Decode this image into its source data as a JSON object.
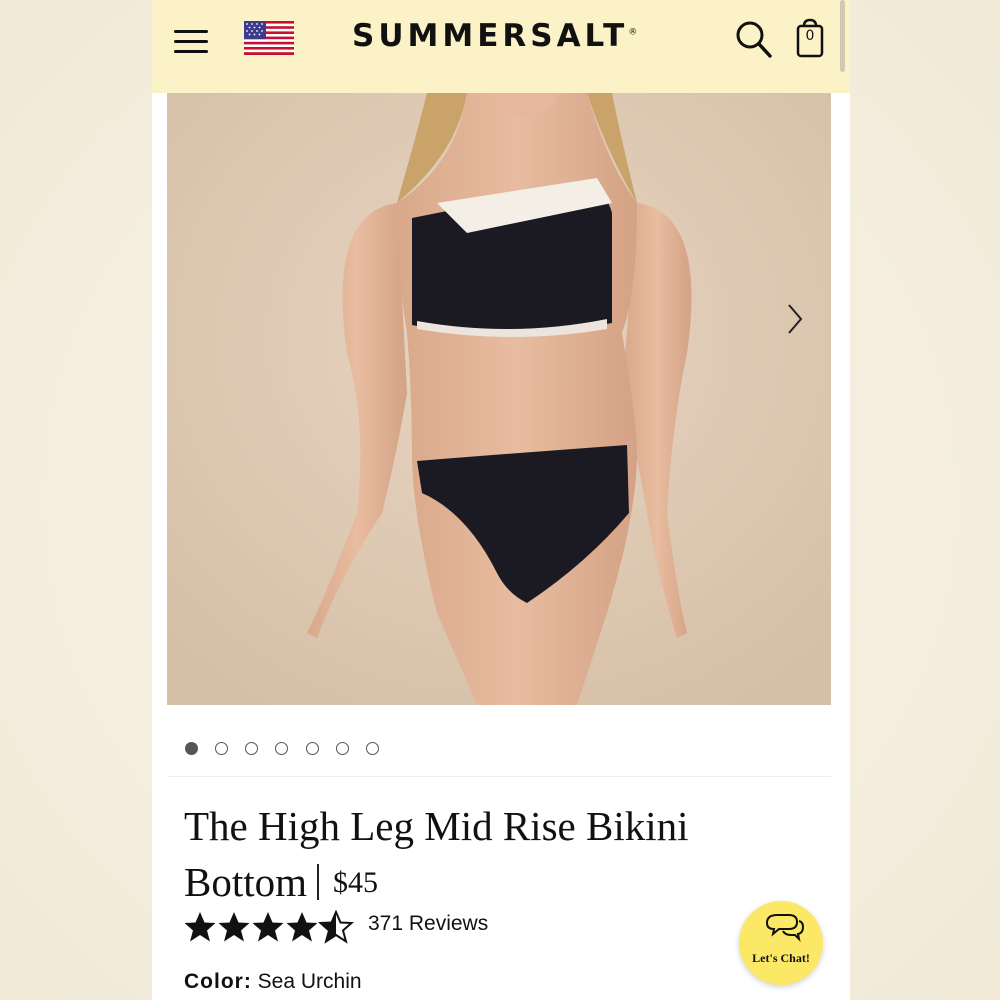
{
  "header": {
    "brand": "SUMMERSALT",
    "brand_mark": "®",
    "cart_count": "0",
    "flag": "us-flag-icon",
    "background": "#fbf3c7"
  },
  "gallery": {
    "image_description_icon": "product-photo",
    "slide_count": 7,
    "active_slide": 1
  },
  "product": {
    "title": "The High Leg Mid Rise Bikini Bottom",
    "price": "$45",
    "rating": 4.5,
    "reviews": "371 Reviews",
    "color_label": "Color:",
    "color_value": "Sea Urchin"
  },
  "chat": {
    "label": "Let's Chat!",
    "color": "#fbe866"
  }
}
